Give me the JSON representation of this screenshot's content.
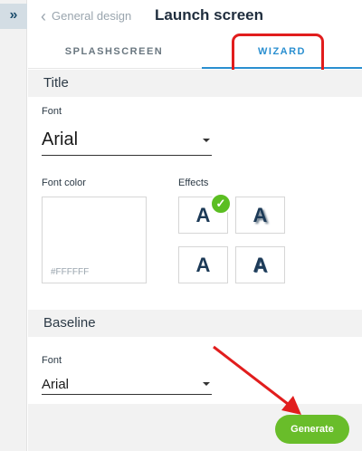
{
  "rail": {
    "expand_icon": "»"
  },
  "header": {
    "back_label": "General design",
    "title": "Launch screen"
  },
  "tabs": [
    {
      "label": "SPLASHSCREEN",
      "active": false
    },
    {
      "label": "WIZARD",
      "active": true
    }
  ],
  "title_section": {
    "heading": "Title",
    "font_label": "Font",
    "font_value": "Arial",
    "font_color_label": "Font color",
    "font_color_value": "#FFFFFF",
    "effects_label": "Effects",
    "effects": [
      {
        "glyph": "A",
        "style": "plain",
        "selected": true
      },
      {
        "glyph": "A",
        "style": "shadow",
        "selected": false
      },
      {
        "glyph": "A",
        "style": "plain-bold",
        "selected": false
      },
      {
        "glyph": "A",
        "style": "outline",
        "selected": false
      }
    ]
  },
  "baseline_section": {
    "heading": "Baseline",
    "font_label": "Font",
    "font_value": "Arial"
  },
  "footer": {
    "generate_label": "Generate"
  },
  "colors": {
    "accent": "#2a8fd0",
    "generate_green": "#69bd2a",
    "annotation_red": "#e11d1d",
    "check_green": "#5bbe22"
  }
}
